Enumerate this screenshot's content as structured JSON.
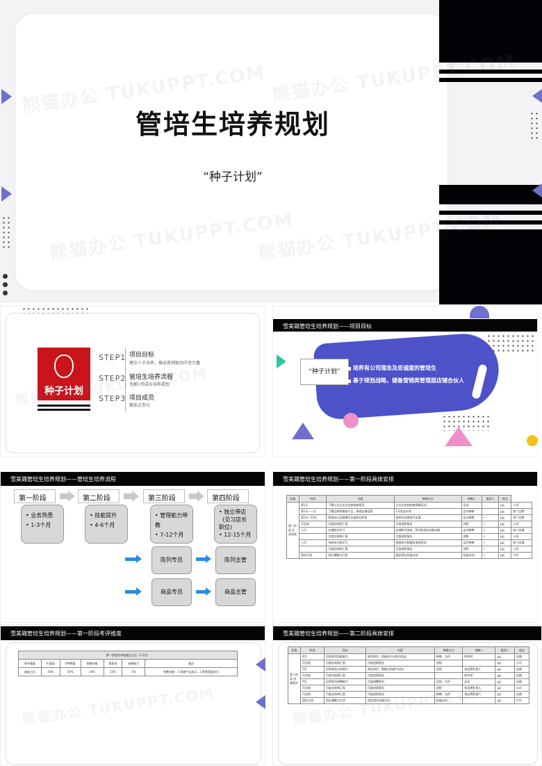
{
  "watermark": "熊猫办公 TUKUPPT.COM",
  "cover": {
    "title": "管培生培养规划",
    "subtitle": "“种子计划”"
  },
  "slide2": {
    "logo_text": "种子计划",
    "steps": [
      {
        "label": "STEP1",
        "title": "项目目标",
        "desc": "健全人才培养，输出育销驱动中坚力量"
      },
      {
        "label": "STEP2",
        "title": "管培生培养流程",
        "desc": "为期1年成长培养规划"
      },
      {
        "label": "STEP3",
        "title": "项目成员",
        "desc": "教练式参与"
      }
    ]
  },
  "slide3": {
    "header": "雪美璐管培生培养规划——项目目标",
    "goal_label": "“种子计划”",
    "bullets": [
      "培养有公司理念及忠诚度的管培生",
      "基于规划战略，储备营销类管理层店铺合伙人"
    ]
  },
  "slide4": {
    "header": "雪美璐管培生培养规划——管培生培养流程",
    "phases": [
      {
        "name": "第一阶段",
        "items": [
          "业务熟悉",
          "1-3个月"
        ]
      },
      {
        "name": "第二阶段",
        "items": [
          "技能提升",
          "4-6个月"
        ]
      },
      {
        "name": "第三阶段",
        "items": [
          "管理能力带教",
          "7-12个月"
        ]
      },
      {
        "name": "第四阶段",
        "items": [
          "独立带店",
          "(见习店长职位)",
          "12-15个月"
        ]
      }
    ],
    "roles_left": [
      "陈列专员",
      "商品专员"
    ],
    "roles_right": [
      "陈列主管",
      "商品主管"
    ]
  },
  "slide5": {
    "header": "雪美璐管培生培养规划——第一阶段具体安排",
    "columns": [
      "阶段",
      "时间",
      "内容",
      "带教方式",
      "带教人",
      "跟进人",
      "地点"
    ],
    "stage": "第一阶段 业务熟悉",
    "rows": [
      [
        "第1天",
        "了解公司企业文化和制度规范",
        "企业文化和制度规章培训",
        "培训",
        "",
        "HR",
        "公司"
      ],
      [
        "第1天~一天",
        "了解品牌风格和产品、熟悉店铺运营",
        "1天驻店计划",
        "店内带教",
        "",
        "HR",
        "各个品牌"
      ],
      [
        "第1天~30天",
        "熟悉店内运营模式及各岗位职责",
        "各岗位轮换进行实操",
        "店内带教",
        "*",
        "HR",
        "各个品牌"
      ],
      [
        "月总结",
        "月度总结和汇报",
        "月度述职报告",
        "述职",
        "*",
        "HR",
        "公司"
      ],
      [
        "二月",
        "店铺陈列学习",
        "店铺陈列流程、陈列标准及技能训练",
        "店内带教",
        "*",
        "HR",
        "各个店铺"
      ],
      [
        "",
        "月度总结和汇报",
        "月度述职报告",
        "述职",
        "*",
        "HR",
        "公司"
      ],
      [
        "三月",
        "电商技巧和学习",
        "电商技巧和服务流程培训",
        "店内带教",
        "*",
        "HR",
        "各个店铺"
      ],
      [
        "",
        "月度总结和汇报",
        "月度述职报告",
        "述职",
        "*",
        "HR",
        "公司"
      ],
      [
        "团队打造",
        "团队凝聚力打造",
        "组织团队拓展活动",
        "拓展活动",
        "*",
        "HR",
        "户外"
      ]
    ]
  },
  "slide6": {
    "header": "雪美璐管培生培养规划——第一阶段考评维度",
    "caption": "第一阶段考评维度及占比（1-3月）",
    "columns": [
      "考评维度",
      "价值观",
      "KPI数据",
      "销售技能",
      "素质项",
      "创新能力",
      "备注"
    ],
    "row": [
      "维度占比",
      "20%",
      "50%",
      "10%",
      "15%",
      "5%",
      "销售技能：1.熟悉产品卖点；2.熟悉搭配技巧"
    ]
  },
  "slide7": {
    "header": "雪美璐管培生培养规划——第二阶段具体安排",
    "columns": [
      "阶段",
      "时间",
      "目标",
      "内容",
      "带教方式",
      "带教人",
      "跟进人",
      "地点"
    ],
    "stage": "第二阶段 技能提升",
    "rows": [
      [
        "4月",
        "培养陈列搭配能力",
        "陈列知识、搭配技巧与陈列培训",
        "带教、点评",
        "陈列师",
        "HR",
        "店铺"
      ],
      [
        "月总结",
        "月度总结和汇报",
        "月度述职报告",
        "述职",
        "",
        "HR",
        "公司"
      ],
      [
        "5月",
        "培养商品分析能力",
        "商品知识、数据分析能力培训",
        "述职",
        "各品牌负责人",
        "HR",
        "店铺"
      ],
      [
        "月总结",
        "月度总结和汇报",
        "月度述职报告",
        "",
        "陈列师",
        "HR",
        "店铺"
      ],
      [
        "6月",
        "培养陈列调整能力",
        "月度调整陈列",
        "实地、点评",
        "店长",
        "HR",
        "店铺"
      ],
      [
        "月总结",
        "月度总结和汇报",
        "月度述职报告",
        "述职",
        "各品牌负责人",
        "HR",
        "公司"
      ],
      [
        "月总结",
        "月度总结和汇报",
        "月度述职报告",
        "带教、点评",
        "各品牌负责人",
        "HR",
        "店铺"
      ],
      [
        "团队打造",
        "团队凝聚力打造",
        "组织团队拓展活动",
        "拓展活动",
        "",
        "HR",
        "户外"
      ]
    ]
  }
}
